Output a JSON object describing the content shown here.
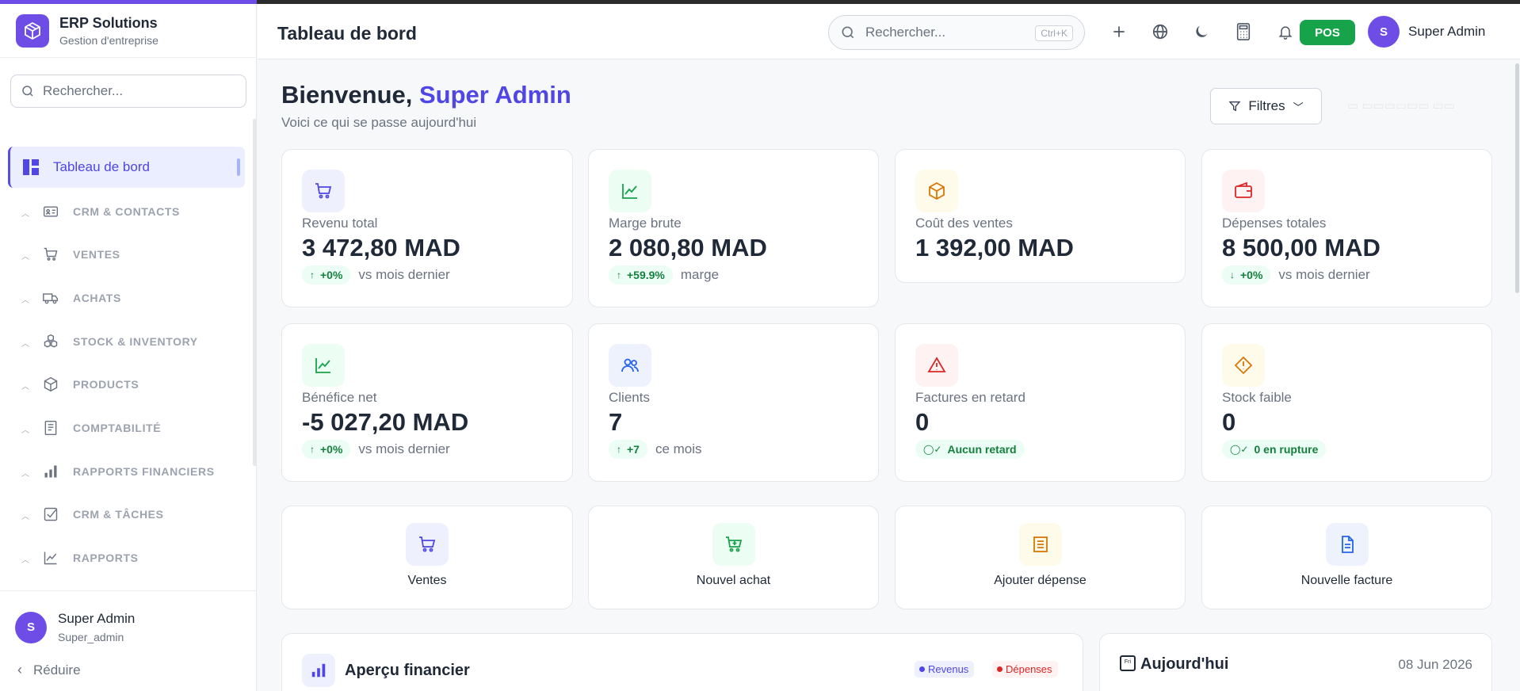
{
  "app": {
    "name": "ERP Solutions",
    "tagline": "Gestion d'entreprise"
  },
  "sidebar": {
    "search_placeholder": "Rechercher...",
    "active_item": "Tableau de bord",
    "items": [
      {
        "label": "CRM & CONTACTS",
        "icon": "contact-card-icon"
      },
      {
        "label": "VENTES",
        "icon": "cart-icon"
      },
      {
        "label": "ACHATS",
        "icon": "truck-icon"
      },
      {
        "label": "STOCK & INVENTORY",
        "icon": "boxes-icon"
      },
      {
        "label": "PRODUCTS",
        "icon": "package-icon"
      },
      {
        "label": "COMPTABILITÉ",
        "icon": "ledger-icon"
      },
      {
        "label": "RAPPORTS FINANCIERS",
        "icon": "bar-chart-icon"
      },
      {
        "label": "CRM & TÂCHES",
        "icon": "checkbox-icon"
      },
      {
        "label": "RAPPORTS",
        "icon": "line-chart-icon"
      }
    ],
    "user": {
      "initial": "S",
      "name": "Super Admin",
      "role": "Super_admin"
    },
    "collapse_label": "Réduire"
  },
  "header": {
    "title": "Tableau de bord",
    "search_placeholder": "Rechercher...",
    "shortcut": "Ctrl+K",
    "pos_label": "POS",
    "user_initial": "S",
    "user_name": "Super Admin"
  },
  "main": {
    "welcome_prefix": "Bienvenue, ",
    "welcome_name": "Super Admin",
    "subtitle": "Voici ce qui se passe aujourd'hui",
    "filters_label": "Filtres",
    "kpis": [
      {
        "label": "Revenu total",
        "value": "3 472,80 MAD",
        "badge": "+0%",
        "note": "vs mois dernier",
        "icon": "cart-icon"
      },
      {
        "label": "Marge brute",
        "value": "2 080,80 MAD",
        "badge": "+59.9%",
        "note": "marge",
        "icon": "trend-up-icon"
      },
      {
        "label": "Coût des ventes",
        "value": "1 392,00 MAD",
        "icon": "box-icon"
      },
      {
        "label": "Dépenses totales",
        "value": "8 500,00 MAD",
        "badge": "+0%",
        "note": "vs mois dernier",
        "icon": "wallet-icon"
      },
      {
        "label": "Bénéfice net",
        "value": "-5 027,20 MAD",
        "badge": "+0%",
        "note": "vs mois dernier",
        "icon": "trend-up-icon"
      },
      {
        "label": "Clients",
        "value": "7",
        "badge": "+7",
        "note": "ce mois",
        "icon": "users-icon"
      },
      {
        "label": "Factures en retard",
        "value": "0",
        "badge": "Aucun retard",
        "icon": "warning-triangle-icon"
      },
      {
        "label": "Stock faible",
        "value": "0",
        "badge": "0 en rupture",
        "icon": "warning-diamond-icon"
      }
    ],
    "actions": [
      {
        "label": "Ventes",
        "icon": "cart-icon"
      },
      {
        "label": "Nouvel achat",
        "icon": "cart-plus-icon"
      },
      {
        "label": "Ajouter dépense",
        "icon": "receipt-icon"
      },
      {
        "label": "Nouvelle facture",
        "icon": "document-icon"
      }
    ],
    "financial": {
      "title": "Aperçu financier",
      "legend_revenus": "Revenus",
      "legend_depenses": "Dépenses"
    },
    "today": {
      "title": "Aujourd'hui",
      "calendar_badge": "Fri",
      "date": "08 Jun 2026"
    }
  },
  "colors": {
    "accent": "#4f46e5",
    "brand": "#6d4de6",
    "success": "#16a34a",
    "danger": "#dc2626"
  }
}
